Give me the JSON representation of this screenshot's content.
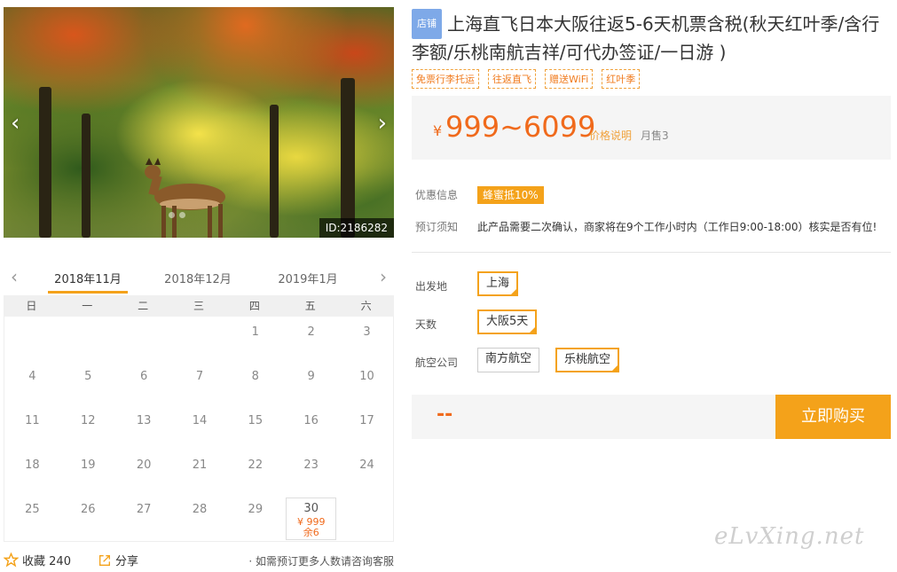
{
  "photo": {
    "id_label": "ID:2186282",
    "prev_arrow": "‹",
    "next_arrow": "›"
  },
  "calendar": {
    "prev": "‹",
    "next": "›",
    "months": [
      "2018年11月",
      "2018年12月",
      "2019年1月"
    ],
    "active_month": 0,
    "weekdays": [
      "日",
      "一",
      "二",
      "三",
      "四",
      "五",
      "六"
    ],
    "first_weekday": 4,
    "days_in_month": 30,
    "available": [
      {
        "day": "30",
        "price": "¥ 999",
        "stock": "余6"
      }
    ]
  },
  "actions": {
    "favorite_label": "收藏",
    "favorite_count": "240",
    "share_label": "分享",
    "note": "· 如需预订更多人数请咨询客服"
  },
  "product": {
    "badge": "店铺",
    "title": "上海直飞日本大阪往返5-6天机票含税(秋天红叶季/含行李额/乐桃南航吉祥/可代办签证/一日游 )",
    "tags": [
      "免票行李托运",
      "往返直飞",
      "赠送WiFi",
      "红叶季"
    ]
  },
  "price": {
    "currency": "¥",
    "range": "999~6099",
    "explain": "价格说明",
    "monthly_sales": "月售3"
  },
  "promo": {
    "label": "优惠信息",
    "badge": "蜂蜜抵10%"
  },
  "booking_note": {
    "label": "预订须知",
    "text": "此产品需要二次确认，商家将在9个工作小时内（工作日9:00-18:00）核实是否有位!"
  },
  "options": {
    "departure": {
      "label": "出发地",
      "values": [
        "上海"
      ],
      "selected": 0
    },
    "days": {
      "label": "天数",
      "values": [
        "大阪5天"
      ],
      "selected": 0
    },
    "airline": {
      "label": "航空公司",
      "values": [
        "南方航空",
        "乐桃航空"
      ],
      "selected": 1
    }
  },
  "buy": {
    "price_placeholder": "--",
    "button": "立即购买"
  },
  "watermark": "eLvXing.net",
  "colors": {
    "accent": "#f4a21a",
    "price": "#f06a1c",
    "badge_blue": "#7ea9e8"
  }
}
